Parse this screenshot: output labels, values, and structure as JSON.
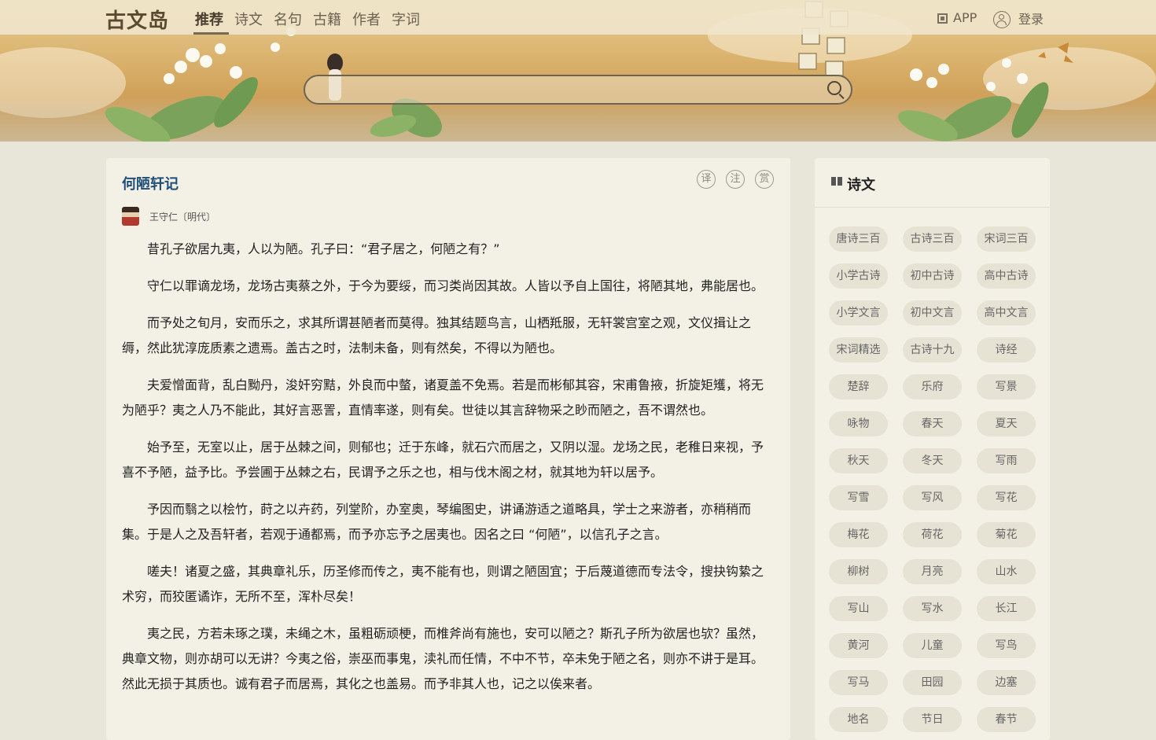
{
  "nav": {
    "logo": "古文岛",
    "items": [
      "推荐",
      "诗文",
      "名句",
      "古籍",
      "作者",
      "字词"
    ],
    "app_label": "APP",
    "login_label": "登录"
  },
  "search": {
    "placeholder": ""
  },
  "poem": {
    "title": "何陋轩记",
    "tools": [
      "译",
      "注",
      "赏"
    ],
    "author": "王守仁〔明代〕",
    "paragraphs": [
      "昔孔子欲居九夷，人以为陋。孔子曰：“君子居之，何陋之有？”",
      "守仁以罪谪龙场，龙场古夷蔡之外，于今为要绥，而习类尚因其故。人皆以予自上国往，将陋其地，弗能居也。",
      "而予处之旬月，安而乐之，求其所谓甚陋者而莫得。独其结题鸟言，山栖羝服，无轩裳宫室之观，文仪揖让之缛，然此犹淳庞质素之遗焉。盖古之时，法制未备，则有然矣，不得以为陋也。",
      "夫爱憎面背，乱白黝丹，浚奸穷黠，外良而中螫，诸夏盖不免焉。若是而彬郁其容，宋甫鲁掖，折旋矩矱，将无为陋乎？夷之人乃不能此，其好言恶詈，直情率遂，则有矣。世徒以其言辞物采之眇而陋之，吾不谓然也。",
      "始予至，无室以止，居于丛棘之间，则郁也；迁于东峰，就石穴而居之，又阴以湿。龙场之民，老稚日来视，予喜不予陋，益予比。予尝圃于丛棘之右，民谓予之乐之也，相与伐木阁之材，就其地为轩以居予。",
      "予因而翳之以桧竹，莳之以卉药，列堂阶，办室奥，琴编图史，讲诵游适之道略具，学士之来游者，亦稍稍而集。于是人之及吾轩者，若观于通都焉，而予亦忘予之居夷也。因名之曰 “何陋”，以信孔子之言。",
      "嗟夫！诸夏之盛，其典章礼乐，历圣修而传之，夷不能有也，则谓之陋固宜；于后蔑道德而专法令，搜抉钩絷之术穷，而狡匿谲诈，无所不至，浑朴尽矣！",
      "夷之民，方若未琢之璞，未绳之木，虽粗砺顽梗，而椎斧尚有施也，安可以陋之？斯孔子所为欲居也欤？虽然，典章文物，则亦胡可以无讲？今夷之俗，崇巫而事鬼，渎礼而任情，不中不节，卒未免于陋之名，则亦不讲于是耳。然此无损于其质也。诚有君子而居焉，其化之也盖易。而予非其人也，记之以俟来者。"
    ]
  },
  "sidebar": {
    "title": "诗文",
    "tags": [
      "唐诗三百",
      "古诗三百",
      "宋词三百",
      "小学古诗",
      "初中古诗",
      "高中古诗",
      "小学文言",
      "初中文言",
      "高中文言",
      "宋词精选",
      "古诗十九",
      "诗经",
      "楚辞",
      "乐府",
      "写景",
      "咏物",
      "春天",
      "夏天",
      "秋天",
      "冬天",
      "写雨",
      "写雪",
      "写风",
      "写花",
      "梅花",
      "荷花",
      "菊花",
      "柳树",
      "月亮",
      "山水",
      "写山",
      "写水",
      "长江",
      "黄河",
      "儿童",
      "写鸟",
      "写马",
      "田园",
      "边塞",
      "地名",
      "节日",
      "春节"
    ]
  }
}
